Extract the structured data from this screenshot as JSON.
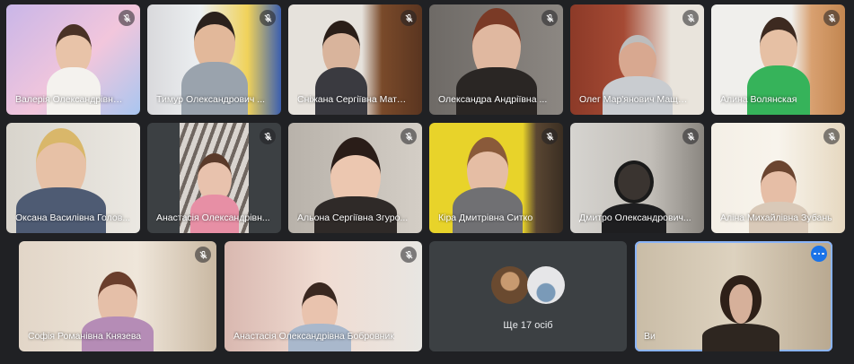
{
  "participants": [
    {
      "name": "Валерія Олександрівна ...",
      "muted": true
    },
    {
      "name": "Тимур Олександрович ...",
      "muted": true
    },
    {
      "name": "Сніжана Сергіївна Мате...",
      "muted": true
    },
    {
      "name": "Олександра Андріївна ...",
      "muted": true
    },
    {
      "name": "Олег Мар'янович Мащак...",
      "muted": true
    },
    {
      "name": "Алина Волянская",
      "muted": true
    },
    {
      "name": "Оксана Василівна Голов...",
      "muted": false
    },
    {
      "name": "Анастасія Олександрівн...",
      "muted": true
    },
    {
      "name": "Альона Сергіївна Згуро...",
      "muted": true
    },
    {
      "name": "Кіра Дмитрівна Ситко",
      "muted": true
    },
    {
      "name": "Дмитро Олександрович...",
      "muted": true
    },
    {
      "name": "Аліна Михайлівна Зубань",
      "muted": true
    },
    {
      "name": "Софія Романівна Князева",
      "muted": true
    },
    {
      "name": "Анастасія Олександрівна Бобровник",
      "muted": true
    }
  ],
  "others_tile": {
    "label": "Ще 17 осіб"
  },
  "self_tile": {
    "label": "Ви"
  },
  "icons": {
    "muted": "mic-off-icon",
    "more": "more-options-icon"
  },
  "colors": {
    "background": "#202124",
    "tile": "#3c4043",
    "self_outline": "#8ab4f8",
    "more_button": "#1a73e8"
  }
}
